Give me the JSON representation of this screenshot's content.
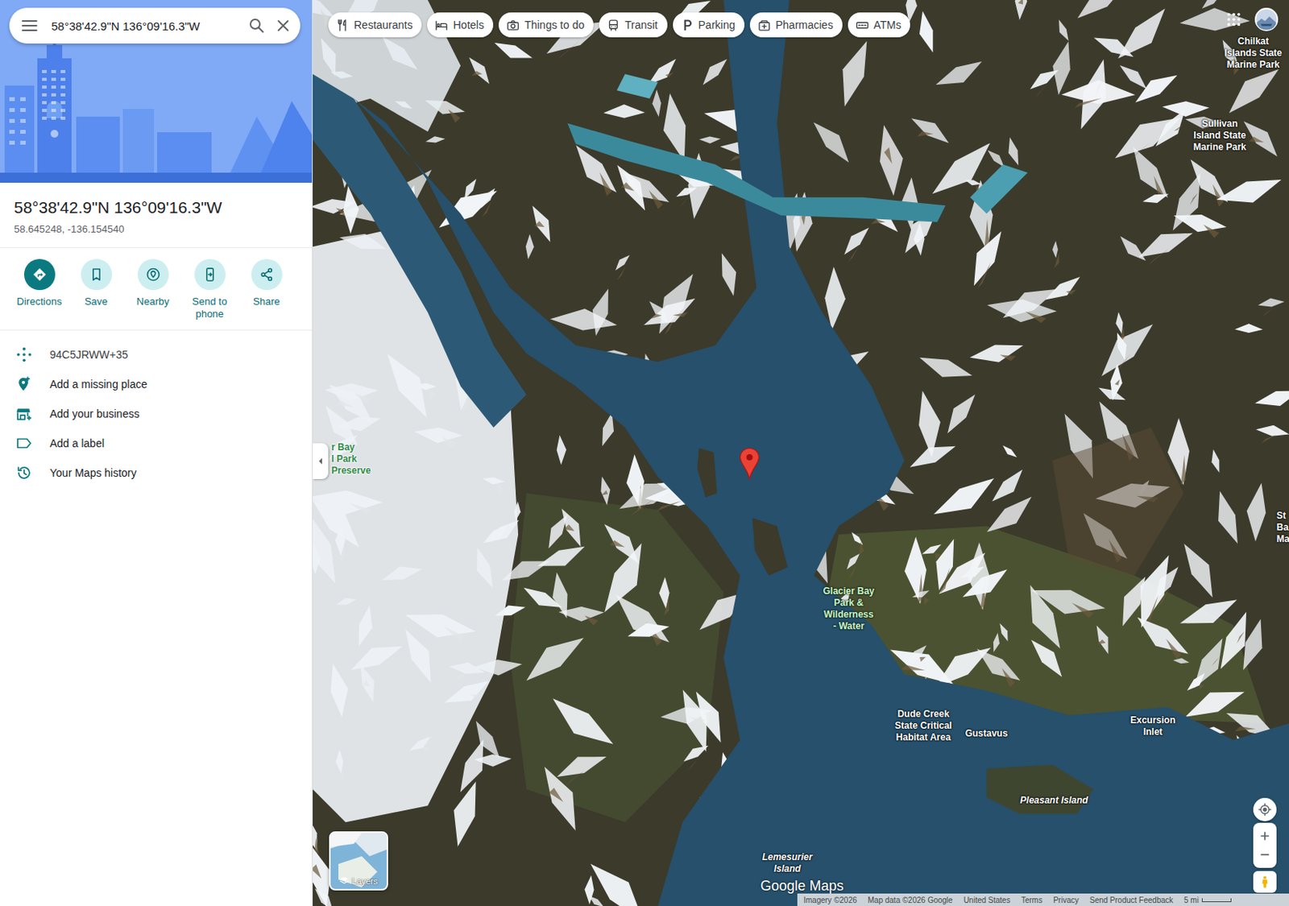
{
  "search": {
    "value": "58°38'42.9\"N 136°09'16.3\"W"
  },
  "place": {
    "title": "58°38'42.9\"N 136°09'16.3\"W",
    "coordinates": "58.645248, -136.154540"
  },
  "actions": [
    {
      "label": "Directions",
      "primary": true,
      "kind": "directions"
    },
    {
      "label": "Save",
      "primary": false,
      "kind": "save"
    },
    {
      "label": "Nearby",
      "primary": false,
      "kind": "nearby"
    },
    {
      "label": "Send to phone",
      "primary": false,
      "kind": "phone"
    },
    {
      "label": "Share",
      "primary": false,
      "kind": "share"
    }
  ],
  "details": [
    {
      "text": "94C5JRWW+35",
      "kind": "pluscode"
    },
    {
      "text": "Add a missing place",
      "kind": "addplace"
    },
    {
      "text": "Add your business",
      "kind": "business"
    },
    {
      "text": "Add a label",
      "kind": "label"
    },
    {
      "text": "Your Maps history",
      "kind": "history"
    }
  ],
  "chips": [
    {
      "label": "Restaurants",
      "kind": "restaurants"
    },
    {
      "label": "Hotels",
      "kind": "hotels"
    },
    {
      "label": "Things to do",
      "kind": "things"
    },
    {
      "label": "Transit",
      "kind": "transit"
    },
    {
      "label": "Parking",
      "kind": "parking"
    },
    {
      "label": "Pharmacies",
      "kind": "pharmacies"
    },
    {
      "label": "ATMs",
      "kind": "atm"
    }
  ],
  "map_labels": [
    {
      "lines": [
        "Chilkat",
        "Islands State",
        "Marine Park"
      ],
      "kind": "place"
    },
    {
      "lines": [
        "Sullivan",
        "Island State",
        "Marine Park"
      ],
      "kind": "place"
    },
    {
      "lines": [
        "St",
        "Ba",
        "Ma"
      ],
      "kind": "place"
    },
    {
      "lines": [
        "r Bay",
        "l Park",
        "Preserve"
      ],
      "kind": "park-edge"
    },
    {
      "lines": [
        "Glacier Bay",
        "Park &",
        "Wilderness",
        "- Water"
      ],
      "kind": "park"
    },
    {
      "lines": [
        "Dude Creek",
        "State Critical",
        "Habitat Area"
      ],
      "kind": "place"
    },
    {
      "lines": [
        "Gustavus"
      ],
      "kind": "place"
    },
    {
      "lines": [
        "Excursion",
        "Inlet"
      ],
      "kind": "place"
    },
    {
      "lines": [
        "Pleasant Island"
      ],
      "kind": "island"
    },
    {
      "lines": [
        "Lemesurier",
        "Island"
      ],
      "kind": "island"
    }
  ],
  "layers": {
    "label": "Layers"
  },
  "logo": "Google Maps",
  "footer": [
    "Imagery ©2026",
    "Map data ©2026 Google",
    "United States",
    "Terms",
    "Privacy",
    "Send Product Feedback",
    "5 mi"
  ]
}
